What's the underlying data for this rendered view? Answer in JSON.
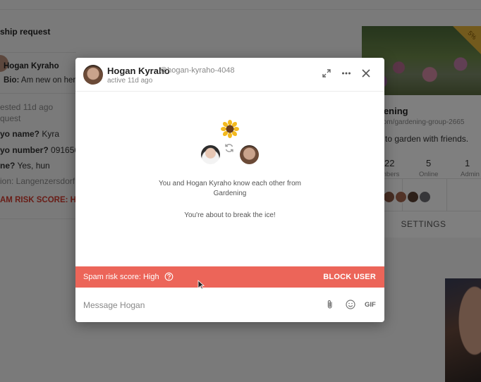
{
  "background": {
    "left_panel": {
      "heading": "ship request",
      "user_name": "Hogan Kyraho",
      "bio_label": "Bio:",
      "bio_text": "Am new on here",
      "requested": "ested 11d ago",
      "request_word": "quest",
      "q1_label": "yo name?",
      "q1_answer": "Kyra",
      "q2_label": "yo number?",
      "q2_answer": "0916563",
      "q3_label": "ne?",
      "q3_answer": "Yes, hun",
      "location": "ion: Langenzersdorf (",
      "spam_score": "AM RISK SCORE: HIG"
    },
    "group_card": {
      "badge": "5%",
      "name": "dening",
      "url": ".com/gardening-group-2665",
      "description": "n to garden with friends.",
      "stats": [
        {
          "value": "22",
          "label": "mbers"
        },
        {
          "value": "5",
          "label": "Online"
        },
        {
          "value": "1",
          "label": "Admin"
        }
      ],
      "settings_label": "SETTINGS"
    }
  },
  "chat_modal": {
    "header": {
      "name": "Hogan Kyraho",
      "handle": "@hogan-kyraho-4048",
      "status": "active 11d ago",
      "icons": [
        "expand-icon",
        "more-icon",
        "close-icon"
      ]
    },
    "body": {
      "common_text_line1": "You and Hogan Kyraho know each other from",
      "common_text_line2": "Gardening",
      "icebreaker_text": "You're about to break the ice!"
    },
    "spam_bar": {
      "label": "Spam risk score: High",
      "action_label": "BLOCK USER",
      "color": "#ec6559"
    },
    "footer": {
      "placeholder": "Message Hogan",
      "gif_label": "GIF"
    }
  }
}
